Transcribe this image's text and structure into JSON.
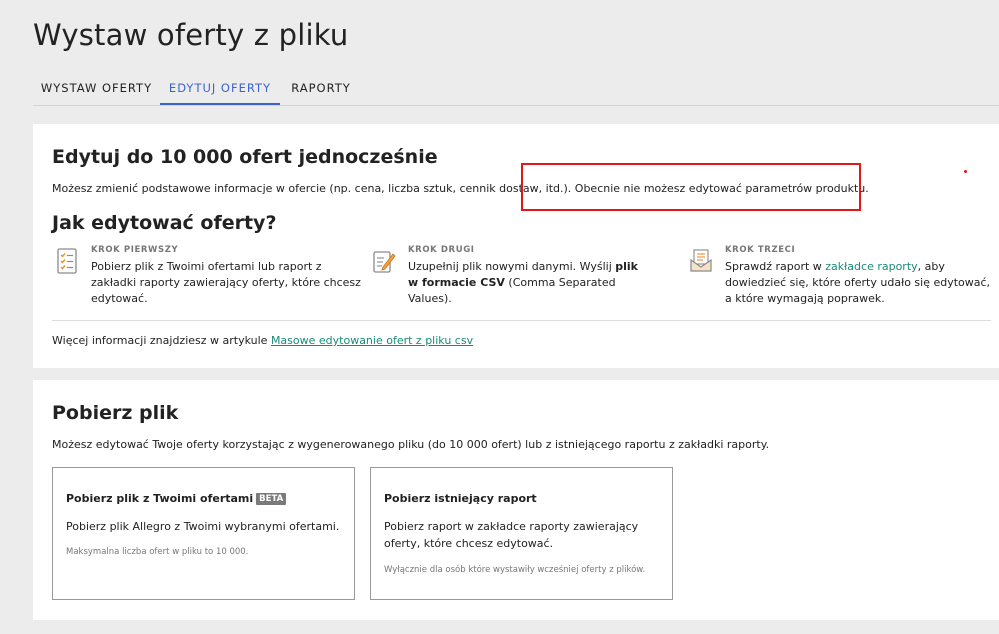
{
  "page": {
    "title": "Wystaw oferty z pliku"
  },
  "tabs": [
    {
      "label": "WYSTAW OFERTY",
      "active": false
    },
    {
      "label": "EDYTUJ OFERTY",
      "active": true
    },
    {
      "label": "RAPORTY",
      "active": false
    }
  ],
  "edit_section": {
    "heading": "Edytuj do 10 000 ofert jednocześnie",
    "description": "Możesz zmienić podstawowe informacje w ofercie (np. cena, liczba sztuk, cennik dostaw, itd.). Obecnie nie możesz edytować parametrów produktu.",
    "how_heading": "Jak edytować oferty?",
    "steps": [
      {
        "icon": "checklist-icon",
        "label": "KROK PIERWSZY",
        "text_before": "Pobierz plik z Twoimi ofertami lub raport z zakładki raporty zawierający oferty, które chcesz edytować."
      },
      {
        "icon": "edit-document-icon",
        "label": "KROK DRUGI",
        "text_before": "Uzupełnij plik nowymi danymi. Wyślij ",
        "bold": "plik w formacie CSV",
        "text_after": " (Comma Separated Values)."
      },
      {
        "icon": "report-envelope-icon",
        "label": "KROK TRZECI",
        "text_before": "Sprawdź raport w ",
        "link": "zakładce raporty",
        "text_after": ", aby dowiedzieć się, które oferty udało się edytować, a które wymagają poprawek."
      }
    ],
    "more_info_text": "Więcej informacji znajdziesz w artykule ",
    "more_info_link": "Masowe edytowanie ofert z pliku csv"
  },
  "download_section": {
    "heading": "Pobierz plik",
    "description": "Możesz edytować Twoje oferty korzystając z wygenerowanego pliku (do 10 000 ofert) lub z istniejącego raportu z zakładki raporty.",
    "options": [
      {
        "title": "Pobierz plik z Twoimi ofertami",
        "badge": "BETA",
        "description": "Pobierz plik Allegro z Twoimi wybranymi ofertami.",
        "note": "Maksymalna liczba ofert w pliku to 10 000."
      },
      {
        "title": "Pobierz istniejący raport",
        "badge": "",
        "description": "Pobierz raport w zakładce raporty zawierający oferty, które chcesz edytować.",
        "note": "Wyłącznie dla osób które wystawiły wcześniej oferty z plików."
      }
    ]
  },
  "colors": {
    "accent_tab": "#3b63c9",
    "link": "#1a8a78",
    "annotation": "#e01818",
    "background": "#ececec"
  }
}
